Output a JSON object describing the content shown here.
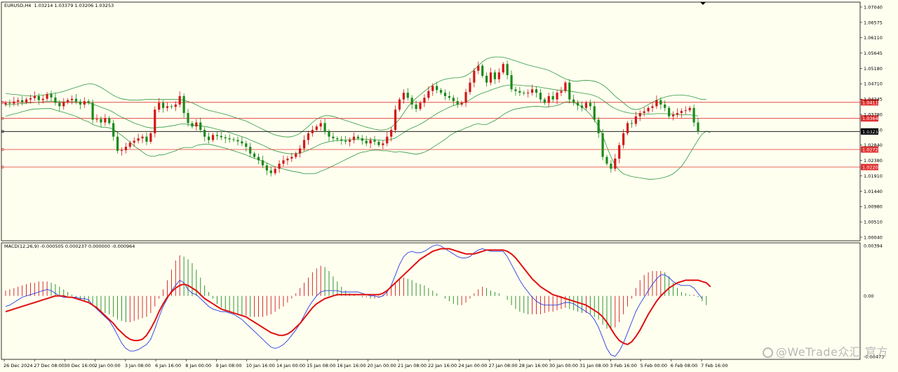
{
  "header": {
    "symbol": "EURUSD,H4",
    "ohlc": "1.03214 1.03379 1.03206 1.03253"
  },
  "macd": {
    "label": "MACD(12,26,9) -0.000505 0.000237 0.000000 -0.000964",
    "scale": [
      "0.00394",
      "0.00",
      "-0.00473"
    ]
  },
  "watermark": "@WeTrade众汇 官方",
  "colors": {
    "bull": "#d01818",
    "bear": "#1a8a1a",
    "band": "#2e9a3e",
    "signal": "#e01010",
    "macdline": "#2a3ce0",
    "bg": "#fffff0",
    "hline": "#e03030"
  },
  "price_axis": [
    "1.07040",
    "1.06575",
    "1.06110",
    "1.05645",
    "1.05180",
    "1.04710",
    "1.04245",
    "1.03780",
    "1.03310",
    "1.02840",
    "1.02380",
    "1.01910",
    "1.01440",
    "1.00980",
    "1.00510",
    "1.00040"
  ],
  "price_range": [
    1.0004,
    1.0704
  ],
  "time_axis": [
    "26 Dec 2024",
    "27 Dec 08:00",
    "30 Dec 16:00",
    "2 Jan 00:00",
    "3 Jan 08:00",
    "6 Jan 16:00",
    "8 Jan 00:00",
    "9 Jan 08:00",
    "10 Jan 16:00",
    "14 Jan 00:00",
    "15 Jan 08:00",
    "16 Jan 16:00",
    "20 Jan 00:00",
    "21 Jan 08:00",
    "22 Jan 16:00",
    "24 Jan 00:00",
    "27 Jan 08:00",
    "28 Jan 16:00",
    "30 Jan 00:00",
    "31 Jan 08:00",
    "3 Feb 16:00",
    "5 Feb 00:00",
    "6 Feb 08:00",
    "7 Feb 16:00"
  ],
  "levels": [
    {
      "price": 1.04115,
      "label": "1.04115",
      "color": "#e03030"
    },
    {
      "price": 1.0364,
      "label": "1.03640",
      "color": "#e03030"
    },
    {
      "price": 1.03253,
      "label": "1.03253",
      "color": "#000000"
    },
    {
      "price": 1.0272,
      "label": "1.02720",
      "color": "#e03030"
    },
    {
      "price": 1.022,
      "label": "1.02200",
      "color": "#e03030"
    }
  ],
  "chart_data": {
    "type": "candlestick",
    "symbol": "EURUSD",
    "timeframe": "H4",
    "close": [
      1.041,
      1.0408,
      1.0414,
      1.0418,
      1.0412,
      1.042,
      1.0424,
      1.043,
      1.0418,
      1.0422,
      1.0436,
      1.0426,
      1.041,
      1.04,
      1.0412,
      1.0418,
      1.0422,
      1.0414,
      1.0405,
      1.0415,
      1.041,
      1.036,
      1.0362,
      1.0352,
      1.0365,
      1.035,
      1.031,
      1.0268,
      1.027,
      1.028,
      1.0292,
      1.0298,
      1.0305,
      1.031,
      1.0295,
      1.032,
      1.039,
      1.041,
      1.0395,
      1.04,
      1.0398,
      1.0405,
      1.043,
      1.038,
      1.035,
      1.034,
      1.0352,
      1.033,
      1.031,
      1.03,
      1.0315,
      1.0312,
      1.0308,
      1.0305,
      1.0302,
      1.03,
      1.0296,
      1.029,
      1.028,
      1.026,
      1.025,
      1.024,
      1.0225,
      1.021,
      1.0202,
      1.0215,
      1.023,
      1.024,
      1.0245,
      1.025,
      1.026,
      1.0275,
      1.03,
      1.032,
      1.033,
      1.034,
      1.035,
      1.0324,
      1.031,
      1.0305,
      1.0302,
      1.0298,
      1.0295,
      1.03,
      1.031,
      1.0305,
      1.0298,
      1.029,
      1.03,
      1.0295,
      1.0285,
      1.029,
      1.031,
      1.033,
      1.039,
      1.042,
      1.044,
      1.0425,
      1.0405,
      1.0392,
      1.041,
      1.0425,
      1.0445,
      1.046,
      1.0448,
      1.044,
      1.043,
      1.0425,
      1.0415,
      1.0405,
      1.041,
      1.0442,
      1.047,
      1.0505,
      1.052,
      1.049,
      1.047,
      1.05,
      1.048,
      1.05,
      1.0525,
      1.0492,
      1.045,
      1.0445,
      1.044,
      1.0438,
      1.044,
      1.045,
      1.044,
      1.042,
      1.041,
      1.043,
      1.042,
      1.044,
      1.0445,
      1.047,
      1.042,
      1.041,
      1.0402,
      1.0395,
      1.041,
      1.04,
      1.036,
      1.032,
      1.025,
      1.023,
      1.0215,
      1.0245,
      1.0285,
      1.032,
      1.035,
      1.0348,
      1.037,
      1.038,
      1.0385,
      1.0395,
      1.04,
      1.0418,
      1.0405,
      1.0395,
      1.037,
      1.0375,
      1.038,
      1.0386,
      1.0388,
      1.0395,
      1.0352,
      1.0325
    ],
    "open_first": 1.0405,
    "bollinger_upper": [
      1.0438,
      1.0436,
      1.0435,
      1.0434,
      1.0432,
      1.0431,
      1.043,
      1.043,
      1.0432,
      1.0433,
      1.0435,
      1.0437,
      1.0439,
      1.0441,
      1.0444,
      1.0448,
      1.0452,
      1.0456,
      1.046,
      1.0464,
      1.0466,
      1.0466,
      1.0462,
      1.0456,
      1.0448,
      1.044,
      1.0432,
      1.0426,
      1.0422,
      1.042,
      1.0418,
      1.0418,
      1.0418,
      1.0419,
      1.042,
      1.042,
      1.042,
      1.042,
      1.042,
      1.042,
      1.042,
      1.042,
      1.042,
      1.0418,
      1.0414,
      1.041,
      1.0404,
      1.0398,
      1.0392,
      1.0388,
      1.0385,
      1.0382,
      1.0379,
      1.0376,
      1.0372,
      1.0368,
      1.0364,
      1.036,
      1.0356,
      1.035,
      1.0344,
      1.0338,
      1.0332,
      1.0326,
      1.032,
      1.0315,
      1.0312,
      1.031,
      1.0309,
      1.031,
      1.0314,
      1.032,
      1.033,
      1.034,
      1.0352,
      1.0362,
      1.0368,
      1.0372,
      1.0372,
      1.037,
      1.0366,
      1.0362,
      1.0358,
      1.0354,
      1.035,
      1.0346,
      1.0342,
      1.0338,
      1.0335,
      1.0332,
      1.033,
      1.033,
      1.0332,
      1.0338,
      1.0348,
      1.0362,
      1.038,
      1.0398,
      1.0412,
      1.0424,
      1.0434,
      1.0444,
      1.0454,
      1.0462,
      1.047,
      1.0476,
      1.048,
      1.0482,
      1.0484,
      1.0484,
      1.0486,
      1.049,
      1.0498,
      1.0508,
      1.052,
      1.0532,
      1.054,
      1.0544,
      1.0546,
      1.0546,
      1.0545,
      1.0542,
      1.0538,
      1.0534,
      1.053,
      1.0526,
      1.0522,
      1.0519,
      1.0516,
      1.0513,
      1.051,
      1.0506,
      1.05,
      1.0494,
      1.0487,
      1.0481,
      1.0477,
      1.0474,
      1.0474,
      1.0476,
      1.0477,
      1.0476,
      1.0474,
      1.047,
      1.0463,
      1.0454,
      1.0442,
      1.043,
      1.042,
      1.041,
      1.04,
      1.0392,
      1.039,
      1.0392,
      1.0398,
      1.0405,
      1.0412,
      1.0418,
      1.0423,
      1.0427,
      1.043,
      1.0432,
      1.0433,
      1.0433,
      1.0432,
      1.043,
      1.0427,
      1.0423,
      1.042,
      1.042
    ],
    "bollinger_middle": [
      1.0404,
      1.0405,
      1.0406,
      1.0407,
      1.0408,
      1.0409,
      1.041,
      1.0411,
      1.0412,
      1.0413,
      1.0414,
      1.0415,
      1.0414,
      1.0413,
      1.0413,
      1.0413,
      1.0413,
      1.0413,
      1.0412,
      1.0411,
      1.041,
      1.0406,
      1.0402,
      1.0397,
      1.0393,
      1.0388,
      1.0382,
      1.0374,
      1.0368,
      1.0362,
      1.0356,
      1.035,
      1.0346,
      1.0342,
      1.0338,
      1.0336,
      1.0336,
      1.0338,
      1.0338,
      1.034,
      1.0342,
      1.0344,
      1.0347,
      1.0348,
      1.0346,
      1.0344,
      1.0344,
      1.0342,
      1.034,
      1.0338,
      1.0335,
      1.0332,
      1.0329,
      1.0326,
      1.0322,
      1.0318,
      1.0314,
      1.031,
      1.0306,
      1.03,
      1.0295,
      1.029,
      1.0285,
      1.0279,
      1.0273,
      1.0268,
      1.0265,
      1.0262,
      1.026,
      1.0259,
      1.026,
      1.0262,
      1.0265,
      1.027,
      1.0276,
      1.0282,
      1.0288,
      1.0292,
      1.0295,
      1.0297,
      1.0298,
      1.0299,
      1.03,
      1.0301,
      1.0302,
      1.0303,
      1.0303,
      1.0302,
      1.0302,
      1.0301,
      1.03,
      1.0299,
      1.03,
      1.0302,
      1.0306,
      1.0314,
      1.0322,
      1.033,
      1.0336,
      1.0341,
      1.0347,
      1.0354,
      1.0362,
      1.037,
      1.0378,
      1.0385,
      1.0391,
      1.0397,
      1.0402,
      1.0405,
      1.0408,
      1.0413,
      1.0419,
      1.0427,
      1.0434,
      1.0439,
      1.0443,
      1.0448,
      1.0452,
      1.0456,
      1.046,
      1.0462,
      1.0463,
      1.0463,
      1.0462,
      1.0461,
      1.046,
      1.0459,
      1.0458,
      1.0456,
      1.0454,
      1.0452,
      1.045,
      1.0448,
      1.0447,
      1.0447,
      1.0445,
      1.0443,
      1.0441,
      1.0439,
      1.0437,
      1.0435,
      1.0431,
      1.0426,
      1.0418,
      1.0409,
      1.04,
      1.0393,
      1.0388,
      1.0384,
      1.0381,
      1.0379,
      1.0378,
      1.0377,
      1.0377,
      1.0377,
      1.0377,
      1.0378,
      1.0378,
      1.0378,
      1.0377,
      1.0376,
      1.0375,
      1.0375,
      1.0375,
      1.0375,
      1.0373,
      1.0371
    ],
    "bollinger_lower": [
      1.037,
      1.0374,
      1.0377,
      1.038,
      1.0384,
      1.0387,
      1.039,
      1.0392,
      1.0392,
      1.0393,
      1.0393,
      1.0393,
      1.0389,
      1.0385,
      1.0382,
      1.0378,
      1.0374,
      1.037,
      1.0364,
      1.0358,
      1.0354,
      1.0346,
      1.0342,
      1.0338,
      1.0338,
      1.0336,
      1.0332,
      1.0322,
      1.0314,
      1.0304,
      1.0294,
      1.0282,
      1.0274,
      1.0265,
      1.0256,
      1.0252,
      1.0252,
      1.0256,
      1.0256,
      1.026,
      1.0264,
      1.0268,
      1.0274,
      1.0278,
      1.0278,
      1.0278,
      1.0284,
      1.0286,
      1.0288,
      1.0288,
      1.0285,
      1.0282,
      1.0279,
      1.0276,
      1.0272,
      1.0268,
      1.0264,
      1.026,
      1.0256,
      1.025,
      1.0246,
      1.0242,
      1.0238,
      1.0232,
      1.0226,
      1.0221,
      1.0218,
      1.0214,
      1.0211,
      1.0208,
      1.0206,
      1.0204,
      1.02,
      1.02,
      1.02,
      1.0202,
      1.0208,
      1.0212,
      1.0218,
      1.0224,
      1.023,
      1.0236,
      1.0242,
      1.0248,
      1.0254,
      1.026,
      1.0264,
      1.0266,
      1.0269,
      1.027,
      1.027,
      1.0268,
      1.0268,
      1.0266,
      1.0264,
      1.0266,
      1.0264,
      1.0262,
      1.026,
      1.0258,
      1.026,
      1.0264,
      1.027,
      1.0278,
      1.0286,
      1.0294,
      1.0302,
      1.0312,
      1.032,
      1.0326,
      1.033,
      1.0336,
      1.034,
      1.0346,
      1.0348,
      1.0346,
      1.0346,
      1.0352,
      1.0358,
      1.0366,
      1.0375,
      1.0382,
      1.0388,
      1.0392,
      1.0394,
      1.0396,
      1.0398,
      1.0399,
      1.04,
      1.0399,
      1.0398,
      1.0398,
      1.04,
      1.0402,
      1.0407,
      1.0413,
      1.0413,
      1.0412,
      1.0405,
      1.0398,
      1.0388,
      1.0376,
      1.036,
      1.034,
      1.0312,
      1.028,
      1.025,
      1.0226,
      1.021,
      1.02,
      1.0196,
      1.0192,
      1.019,
      1.0188,
      1.0186,
      1.0184,
      1.0184,
      1.0185,
      1.0187,
      1.019,
      1.0194,
      1.02,
      1.021,
      1.0222,
      1.024,
      1.026,
      1.028,
      1.03,
      1.0318,
      1.0326,
      1.0322
    ],
    "macd_histogram": [
      0.0004,
      0.0005,
      0.0006,
      0.0007,
      0.0008,
      0.0009,
      0.001,
      0.001,
      0.0011,
      0.0011,
      0.0011,
      0.001,
      0.0009,
      0.0007,
      0.0005,
      0.0003,
      0.0001,
      -0.0001,
      -0.0003,
      -0.0004,
      -0.0005,
      -0.0008,
      -0.001,
      -0.0012,
      -0.0013,
      -0.0014,
      -0.0016,
      -0.0018,
      -0.0019,
      -0.002,
      -0.002,
      -0.0019,
      -0.0018,
      -0.0017,
      -0.0016,
      -0.0013,
      -0.0008,
      -0.0002,
      0.0005,
      0.0012,
      0.002,
      0.0027,
      0.0031,
      0.003,
      0.0028,
      0.0025,
      0.002,
      0.0014,
      0.0008,
      0.0003,
      -0.0002,
      -0.0006,
      -0.0009,
      -0.0011,
      -0.0012,
      -0.0013,
      -0.0014,
      -0.0015,
      -0.0015,
      -0.0016,
      -0.0016,
      -0.0016,
      -0.0016,
      -0.0015,
      -0.0014,
      -0.0012,
      -0.001,
      -0.0008,
      -0.0005,
      -0.0002,
      0.0002,
      0.0006,
      0.001,
      0.0014,
      0.0018,
      0.0021,
      0.0023,
      0.0022,
      0.0019,
      0.0015,
      0.0011,
      0.0007,
      0.0004,
      0.0002,
      0.0001,
      0.0,
      -0.0001,
      -0.0001,
      -0.0002,
      -0.0002,
      -0.0001,
      0.0001,
      0.0004,
      0.0007,
      0.001,
      0.0013,
      0.0014,
      0.0013,
      0.0012,
      0.001,
      0.0009,
      0.0008,
      0.0006,
      0.0004,
      0.0002,
      0.0,
      -0.0002,
      -0.0004,
      -0.0006,
      -0.0007,
      -0.0007,
      -0.0005,
      -0.0002,
      0.0002,
      0.0005,
      0.0007,
      0.0006,
      0.0004,
      0.0003,
      0.0002,
      0.0,
      -0.0003,
      -0.0007,
      -0.001,
      -0.0012,
      -0.0013,
      -0.0014,
      -0.0014,
      -0.0014,
      -0.0014,
      -0.0013,
      -0.0012,
      -0.0012,
      -0.0011,
      -0.001,
      -0.0009,
      -0.001,
      -0.0011,
      -0.0012,
      -0.0013,
      -0.0013,
      -0.0014,
      -0.0016,
      -0.0018,
      -0.0022,
      -0.0025,
      -0.0026,
      -0.0024,
      -0.002,
      -0.0014,
      -0.0008,
      -0.0002,
      0.0006,
      0.0012,
      0.0016,
      0.0018,
      0.0019,
      0.0019,
      0.0019,
      0.0018,
      0.0015,
      0.001,
      0.0006,
      0.0003,
      0.0002,
      0.0001,
      0.0001,
      -0.0001,
      -0.0004,
      -0.0007
    ],
    "macd_line": [
      -0.0008,
      -0.0007,
      -0.0005,
      -0.0003,
      -0.0001,
      0.0,
      0.0001,
      0.0002,
      0.0003,
      0.0004,
      0.0005,
      0.0004,
      0.0002,
      0.0,
      -0.0001,
      -0.0001,
      -0.0001,
      -0.0001,
      -0.0002,
      -0.0002,
      -0.0003,
      -0.0007,
      -0.001,
      -0.0013,
      -0.0016,
      -0.0019,
      -0.0024,
      -0.003,
      -0.0036,
      -0.004,
      -0.0042,
      -0.0042,
      -0.0041,
      -0.0039,
      -0.0037,
      -0.0033,
      -0.0025,
      -0.0016,
      -0.0008,
      -0.0002,
      0.0004,
      0.0008,
      0.0012,
      0.001,
      0.0005,
      0.0002,
      0.0001,
      -0.0002,
      -0.0005,
      -0.0008,
      -0.001,
      -0.0011,
      -0.0012,
      -0.0012,
      -0.0013,
      -0.0014,
      -0.0016,
      -0.0018,
      -0.0021,
      -0.0024,
      -0.0027,
      -0.003,
      -0.0033,
      -0.0036,
      -0.0039,
      -0.004,
      -0.0039,
      -0.0037,
      -0.0034,
      -0.003,
      -0.0026,
      -0.0021,
      -0.0015,
      -0.0009,
      -0.0004,
      0.0,
      0.0003,
      0.0004,
      0.0004,
      0.0004,
      0.0004,
      0.0003,
      0.0003,
      0.0003,
      0.0003,
      0.0003,
      0.0002,
      0.0001,
      0.0,
      0.0,
      -0.0001,
      0.0,
      0.0003,
      0.0008,
      0.0016,
      0.0024,
      0.003,
      0.0033,
      0.0034,
      0.0033,
      0.0033,
      0.0034,
      0.0036,
      0.0038,
      0.0039,
      0.0038,
      0.0036,
      0.0034,
      0.0032,
      0.003,
      0.0029,
      0.0029,
      0.003,
      0.0033,
      0.0035,
      0.0036,
      0.0035,
      0.0034,
      0.0034,
      0.0034,
      0.0034,
      0.003,
      0.0024,
      0.0018,
      0.0012,
      0.0007,
      0.0003,
      -0.0001,
      -0.0004,
      -0.0006,
      -0.0007,
      -0.0007,
      -0.0007,
      -0.0007,
      -0.0006,
      -0.0005,
      -0.0005,
      -0.0006,
      -0.0008,
      -0.001,
      -0.0012,
      -0.0014,
      -0.0018,
      -0.0024,
      -0.0032,
      -0.004,
      -0.0045,
      -0.0046,
      -0.0042,
      -0.0036,
      -0.0028,
      -0.002,
      -0.0012,
      -0.0006,
      -0.0001,
      0.0004,
      0.0009,
      0.0013,
      0.0016,
      0.0016,
      0.0014,
      0.0011,
      0.0009,
      0.0008,
      0.0008,
      0.0008,
      0.0006,
      0.0002,
      -0.0002
    ],
    "macd_signal": [
      -0.0012,
      -0.0011,
      -0.001,
      -0.0009,
      -0.0008,
      -0.0007,
      -0.0006,
      -0.0005,
      -0.0004,
      -0.0003,
      -0.0002,
      -0.0001,
      0.0,
      0.0,
      0.0,
      -0.0001,
      -0.0001,
      -0.0002,
      -0.0003,
      -0.0004,
      -0.0005,
      -0.0007,
      -0.0009,
      -0.0012,
      -0.0015,
      -0.0018,
      -0.0021,
      -0.0025,
      -0.0028,
      -0.0031,
      -0.0033,
      -0.0034,
      -0.0034,
      -0.0033,
      -0.003,
      -0.0025,
      -0.0019,
      -0.0012,
      -0.0006,
      -0.0001,
      0.0003,
      0.0006,
      0.0008,
      0.0009,
      0.0008,
      0.0006,
      0.0004,
      0.0001,
      -0.0002,
      -0.0004,
      -0.0006,
      -0.0008,
      -0.001,
      -0.0011,
      -0.0012,
      -0.0013,
      -0.0014,
      -0.0015,
      -0.0016,
      -0.0018,
      -0.002,
      -0.0022,
      -0.0024,
      -0.0026,
      -0.0028,
      -0.0029,
      -0.003,
      -0.003,
      -0.0029,
      -0.0027,
      -0.0024,
      -0.0021,
      -0.0017,
      -0.0013,
      -0.0009,
      -0.0006,
      -0.0004,
      -0.0002,
      -0.0001,
      0.0,
      0.0001,
      0.0001,
      0.0001,
      0.0001,
      0.0001,
      0.0001,
      0.0001,
      0.0001,
      0.0001,
      0.0001,
      0.0001,
      0.0002,
      0.0004,
      0.0007,
      0.001,
      0.0013,
      0.0016,
      0.0019,
      0.0022,
      0.0025,
      0.0028,
      0.003,
      0.0032,
      0.0034,
      0.0035,
      0.0036,
      0.0036,
      0.0036,
      0.0035,
      0.0034,
      0.0033,
      0.0032,
      0.0032,
      0.0032,
      0.0033,
      0.0034,
      0.0035,
      0.0035,
      0.0035,
      0.0035,
      0.0035,
      0.0034,
      0.0032,
      0.0029,
      0.0025,
      0.0021,
      0.0017,
      0.0013,
      0.001,
      0.0007,
      0.0005,
      0.0003,
      0.0001,
      0.0,
      -0.0001,
      -0.0002,
      -0.0003,
      -0.0004,
      -0.0005,
      -0.0006,
      -0.0007,
      -0.0009,
      -0.0011,
      -0.0013,
      -0.0016,
      -0.002,
      -0.0025,
      -0.003,
      -0.0034,
      -0.0036,
      -0.0037,
      -0.0035,
      -0.0031,
      -0.0026,
      -0.002,
      -0.0014,
      -0.0009,
      -0.0004,
      0.0,
      0.0003,
      0.0006,
      0.0008,
      0.001,
      0.0011,
      0.0012,
      0.0012,
      0.0012,
      0.0012,
      0.0011,
      0.001,
      0.0007
    ],
    "macd_range": [
      -0.00473,
      0.00394
    ]
  }
}
